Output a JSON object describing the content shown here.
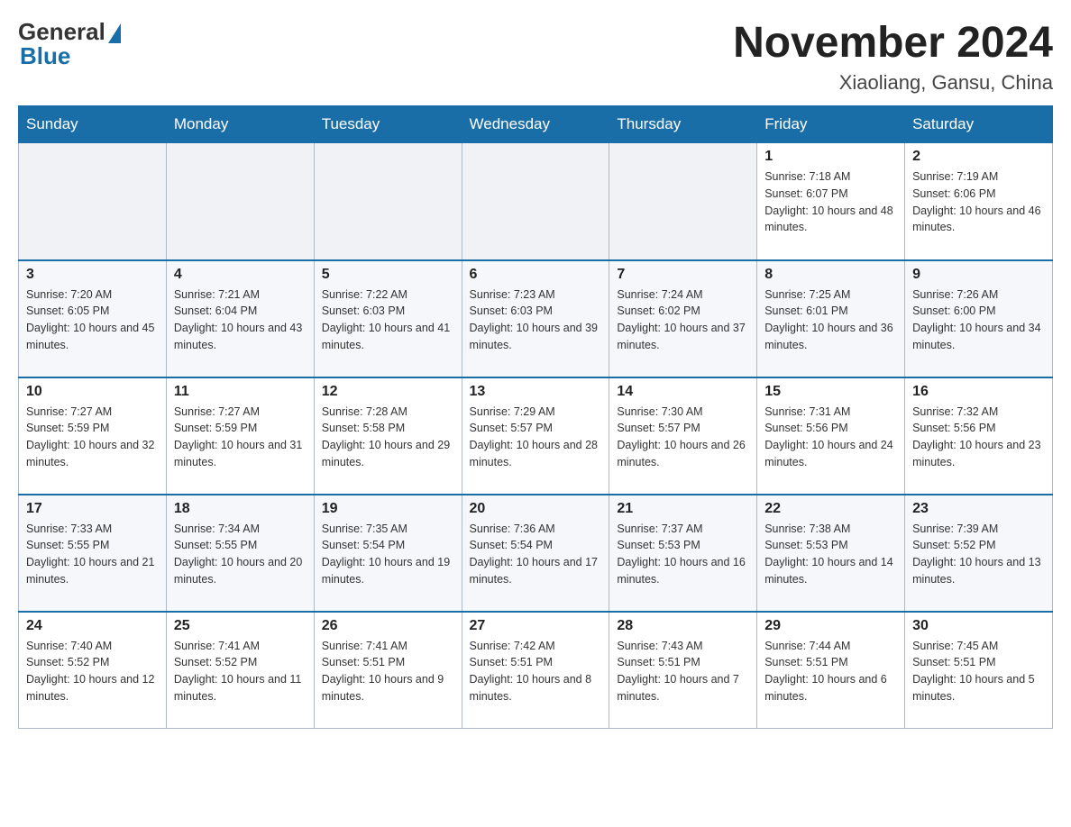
{
  "header": {
    "logo": {
      "general": "General",
      "blue": "Blue"
    },
    "title": "November 2024",
    "subtitle": "Xiaoliang, Gansu, China"
  },
  "days_of_week": [
    "Sunday",
    "Monday",
    "Tuesday",
    "Wednesday",
    "Thursday",
    "Friday",
    "Saturday"
  ],
  "weeks": [
    {
      "days": [
        {
          "number": "",
          "info": ""
        },
        {
          "number": "",
          "info": ""
        },
        {
          "number": "",
          "info": ""
        },
        {
          "number": "",
          "info": ""
        },
        {
          "number": "",
          "info": ""
        },
        {
          "number": "1",
          "info": "Sunrise: 7:18 AM\nSunset: 6:07 PM\nDaylight: 10 hours and 48 minutes."
        },
        {
          "number": "2",
          "info": "Sunrise: 7:19 AM\nSunset: 6:06 PM\nDaylight: 10 hours and 46 minutes."
        }
      ]
    },
    {
      "days": [
        {
          "number": "3",
          "info": "Sunrise: 7:20 AM\nSunset: 6:05 PM\nDaylight: 10 hours and 45 minutes."
        },
        {
          "number": "4",
          "info": "Sunrise: 7:21 AM\nSunset: 6:04 PM\nDaylight: 10 hours and 43 minutes."
        },
        {
          "number": "5",
          "info": "Sunrise: 7:22 AM\nSunset: 6:03 PM\nDaylight: 10 hours and 41 minutes."
        },
        {
          "number": "6",
          "info": "Sunrise: 7:23 AM\nSunset: 6:03 PM\nDaylight: 10 hours and 39 minutes."
        },
        {
          "number": "7",
          "info": "Sunrise: 7:24 AM\nSunset: 6:02 PM\nDaylight: 10 hours and 37 minutes."
        },
        {
          "number": "8",
          "info": "Sunrise: 7:25 AM\nSunset: 6:01 PM\nDaylight: 10 hours and 36 minutes."
        },
        {
          "number": "9",
          "info": "Sunrise: 7:26 AM\nSunset: 6:00 PM\nDaylight: 10 hours and 34 minutes."
        }
      ]
    },
    {
      "days": [
        {
          "number": "10",
          "info": "Sunrise: 7:27 AM\nSunset: 5:59 PM\nDaylight: 10 hours and 32 minutes."
        },
        {
          "number": "11",
          "info": "Sunrise: 7:27 AM\nSunset: 5:59 PM\nDaylight: 10 hours and 31 minutes."
        },
        {
          "number": "12",
          "info": "Sunrise: 7:28 AM\nSunset: 5:58 PM\nDaylight: 10 hours and 29 minutes."
        },
        {
          "number": "13",
          "info": "Sunrise: 7:29 AM\nSunset: 5:57 PM\nDaylight: 10 hours and 28 minutes."
        },
        {
          "number": "14",
          "info": "Sunrise: 7:30 AM\nSunset: 5:57 PM\nDaylight: 10 hours and 26 minutes."
        },
        {
          "number": "15",
          "info": "Sunrise: 7:31 AM\nSunset: 5:56 PM\nDaylight: 10 hours and 24 minutes."
        },
        {
          "number": "16",
          "info": "Sunrise: 7:32 AM\nSunset: 5:56 PM\nDaylight: 10 hours and 23 minutes."
        }
      ]
    },
    {
      "days": [
        {
          "number": "17",
          "info": "Sunrise: 7:33 AM\nSunset: 5:55 PM\nDaylight: 10 hours and 21 minutes."
        },
        {
          "number": "18",
          "info": "Sunrise: 7:34 AM\nSunset: 5:55 PM\nDaylight: 10 hours and 20 minutes."
        },
        {
          "number": "19",
          "info": "Sunrise: 7:35 AM\nSunset: 5:54 PM\nDaylight: 10 hours and 19 minutes."
        },
        {
          "number": "20",
          "info": "Sunrise: 7:36 AM\nSunset: 5:54 PM\nDaylight: 10 hours and 17 minutes."
        },
        {
          "number": "21",
          "info": "Sunrise: 7:37 AM\nSunset: 5:53 PM\nDaylight: 10 hours and 16 minutes."
        },
        {
          "number": "22",
          "info": "Sunrise: 7:38 AM\nSunset: 5:53 PM\nDaylight: 10 hours and 14 minutes."
        },
        {
          "number": "23",
          "info": "Sunrise: 7:39 AM\nSunset: 5:52 PM\nDaylight: 10 hours and 13 minutes."
        }
      ]
    },
    {
      "days": [
        {
          "number": "24",
          "info": "Sunrise: 7:40 AM\nSunset: 5:52 PM\nDaylight: 10 hours and 12 minutes."
        },
        {
          "number": "25",
          "info": "Sunrise: 7:41 AM\nSunset: 5:52 PM\nDaylight: 10 hours and 11 minutes."
        },
        {
          "number": "26",
          "info": "Sunrise: 7:41 AM\nSunset: 5:51 PM\nDaylight: 10 hours and 9 minutes."
        },
        {
          "number": "27",
          "info": "Sunrise: 7:42 AM\nSunset: 5:51 PM\nDaylight: 10 hours and 8 minutes."
        },
        {
          "number": "28",
          "info": "Sunrise: 7:43 AM\nSunset: 5:51 PM\nDaylight: 10 hours and 7 minutes."
        },
        {
          "number": "29",
          "info": "Sunrise: 7:44 AM\nSunset: 5:51 PM\nDaylight: 10 hours and 6 minutes."
        },
        {
          "number": "30",
          "info": "Sunrise: 7:45 AM\nSunset: 5:51 PM\nDaylight: 10 hours and 5 minutes."
        }
      ]
    }
  ]
}
